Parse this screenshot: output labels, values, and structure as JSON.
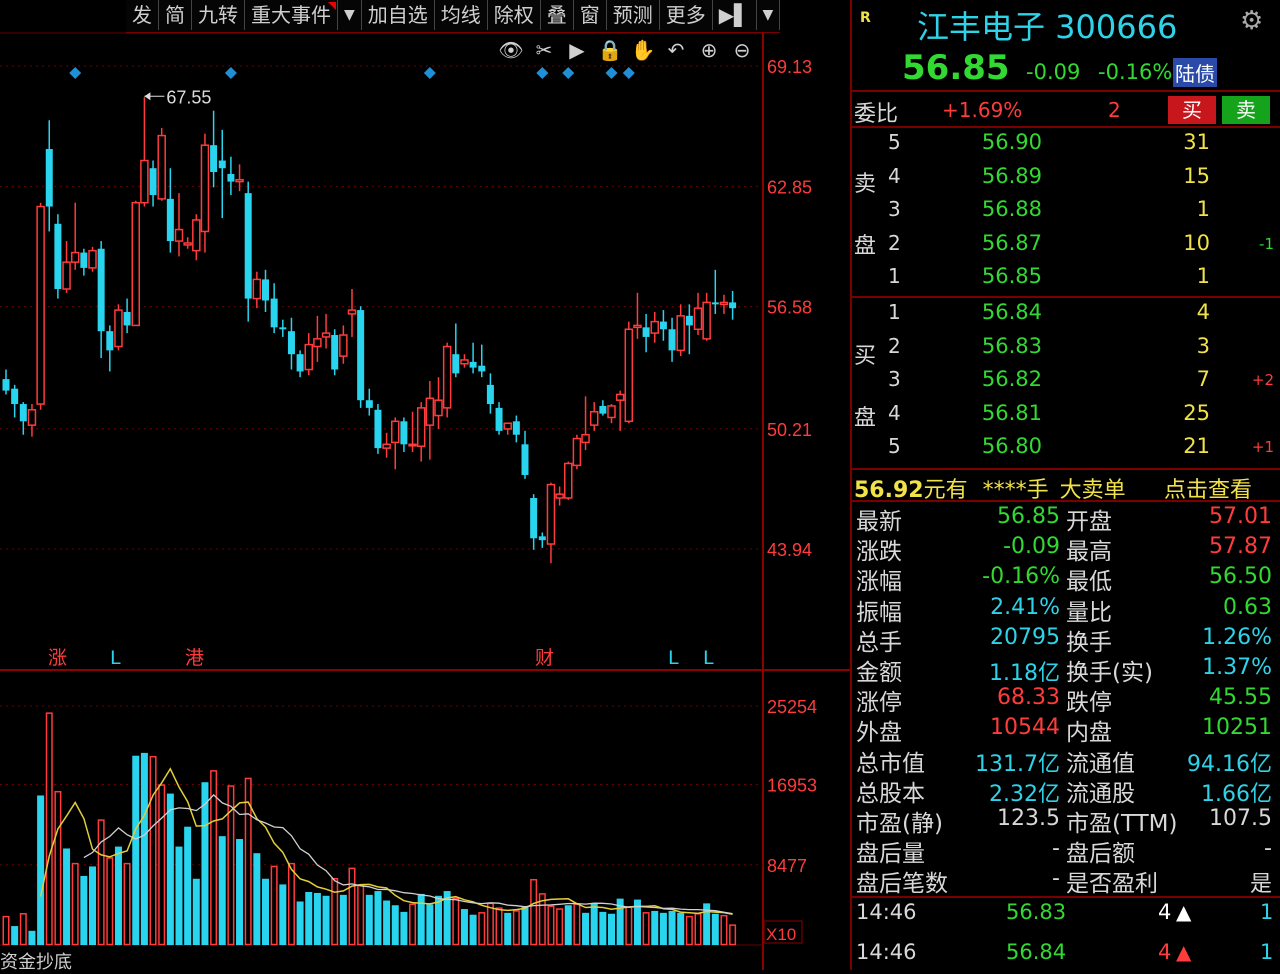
{
  "toolbar": {
    "items": [
      "发",
      "简",
      "九转",
      "重大事件",
      "加自选",
      "均线",
      "除权",
      "叠",
      "窗",
      "预测",
      "更多"
    ]
  },
  "chart_data": {
    "type": "candlestick",
    "price_axis": {
      "ticks": [
        "69.13",
        "62.85",
        "56.58",
        "50.21",
        "43.94"
      ],
      "min": 40,
      "max": 70
    },
    "volume_axis": {
      "ticks": [
        "25254",
        "16953",
        "8477"
      ],
      "unit_label": "X10"
    },
    "max_marker": "67.55",
    "event_markers": [
      "涨",
      "L",
      "港",
      "财",
      "L",
      "L"
    ],
    "candles": [
      [
        52.8,
        53.3,
        52.0,
        52.2
      ],
      [
        52.3,
        52.5,
        50.8,
        51.5
      ],
      [
        51.5,
        51.6,
        49.9,
        50.6
      ],
      [
        50.4,
        51.5,
        49.8,
        51.2
      ],
      [
        51.5,
        62.0,
        51.2,
        61.8
      ],
      [
        64.8,
        66.3,
        60.5,
        61.8
      ],
      [
        60.9,
        61.4,
        57.0,
        57.5
      ],
      [
        57.5,
        60.0,
        57.3,
        58.9
      ],
      [
        58.9,
        62.0,
        58.5,
        59.4
      ],
      [
        59.4,
        59.6,
        58.2,
        58.6
      ],
      [
        58.6,
        59.7,
        58.4,
        59.5
      ],
      [
        59.6,
        60.0,
        53.9,
        55.3
      ],
      [
        55.3,
        55.6,
        53.2,
        54.3
      ],
      [
        54.5,
        56.7,
        54.3,
        56.4
      ],
      [
        56.3,
        57.0,
        55.2,
        55.6
      ],
      [
        55.6,
        62.1,
        55.6,
        62.0
      ],
      [
        62.0,
        67.5,
        61.8,
        64.2
      ],
      [
        63.8,
        64.2,
        61.8,
        62.4
      ],
      [
        62.2,
        65.9,
        62.1,
        65.5
      ],
      [
        62.2,
        63.8,
        59.4,
        60.0
      ],
      [
        60.0,
        62.5,
        59.2,
        60.6
      ],
      [
        59.8,
        60.2,
        59.6,
        59.9
      ],
      [
        59.5,
        61.4,
        59.0,
        61.1
      ],
      [
        60.5,
        65.6,
        59.4,
        65.0
      ],
      [
        65.0,
        66.8,
        62.8,
        63.6
      ],
      [
        64.2,
        65.8,
        61.2,
        63.8
      ],
      [
        63.5,
        64.4,
        62.4,
        63.1
      ],
      [
        63.1,
        64.0,
        62.6,
        63.2
      ],
      [
        62.5,
        63.1,
        55.8,
        57.0
      ],
      [
        57.0,
        58.4,
        56.5,
        58.0
      ],
      [
        58.0,
        58.5,
        56.3,
        56.9
      ],
      [
        57.0,
        57.8,
        55.2,
        55.5
      ],
      [
        55.5,
        55.9,
        55.0,
        55.4
      ],
      [
        55.3,
        56.0,
        53.3,
        54.1
      ],
      [
        54.1,
        54.3,
        52.9,
        53.2
      ],
      [
        53.3,
        55.2,
        53.0,
        54.6
      ],
      [
        54.5,
        56.1,
        53.7,
        54.9
      ],
      [
        55.0,
        56.2,
        54.4,
        55.2
      ],
      [
        55.1,
        55.4,
        53.0,
        53.3
      ],
      [
        54.0,
        55.6,
        53.6,
        55.1
      ],
      [
        56.2,
        57.5,
        55.0,
        56.4
      ],
      [
        56.4,
        56.6,
        51.3,
        51.7
      ],
      [
        51.7,
        52.3,
        50.9,
        51.3
      ],
      [
        51.2,
        51.5,
        48.9,
        49.2
      ],
      [
        49.2,
        50.0,
        48.7,
        49.4
      ],
      [
        49.5,
        50.8,
        48.1,
        50.6
      ],
      [
        50.6,
        50.8,
        49.0,
        49.4
      ],
      [
        49.4,
        51.1,
        49.0,
        49.4
      ],
      [
        49.3,
        51.6,
        48.5,
        51.3
      ],
      [
        50.4,
        52.7,
        48.6,
        51.8
      ],
      [
        50.9,
        52.9,
        50.2,
        51.7
      ],
      [
        51.3,
        54.7,
        50.8,
        54.5
      ],
      [
        54.1,
        55.7,
        52.9,
        53.1
      ],
      [
        53.6,
        54.1,
        53.4,
        53.8
      ],
      [
        53.7,
        54.7,
        53.1,
        53.4
      ],
      [
        53.5,
        54.6,
        52.9,
        53.2
      ],
      [
        52.5,
        53.1,
        51.0,
        51.5
      ],
      [
        51.3,
        51.6,
        49.9,
        50.1
      ],
      [
        50.2,
        50.5,
        49.9,
        50.5
      ],
      [
        50.6,
        50.9,
        49.5,
        49.9
      ],
      [
        49.4,
        50.1,
        47.6,
        47.8
      ],
      [
        46.6,
        46.8,
        43.9,
        44.5
      ],
      [
        44.6,
        44.8,
        44.0,
        44.4
      ],
      [
        44.2,
        47.4,
        43.2,
        47.3
      ],
      [
        46.6,
        47.2,
        46.2,
        46.8
      ],
      [
        46.6,
        48.5,
        46.5,
        48.4
      ],
      [
        48.3,
        49.9,
        48.1,
        49.7
      ],
      [
        49.5,
        51.9,
        49.1,
        49.9
      ],
      [
        50.4,
        51.6,
        50.1,
        51.1
      ],
      [
        51.4,
        51.7,
        50.9,
        51.0
      ],
      [
        50.8,
        51.5,
        50.5,
        51.4
      ],
      [
        51.7,
        52.2,
        50.1,
        52.0
      ],
      [
        50.6,
        55.8,
        50.5,
        55.4
      ],
      [
        55.5,
        57.3,
        54.9,
        55.6
      ],
      [
        55.5,
        56.2,
        54.2,
        55.0
      ],
      [
        55.2,
        56.3,
        54.7,
        55.8
      ],
      [
        55.8,
        56.4,
        54.8,
        55.4
      ],
      [
        55.4,
        56.0,
        53.7,
        54.3
      ],
      [
        54.3,
        56.7,
        54.0,
        56.1
      ],
      [
        56.1,
        56.7,
        54.1,
        55.6
      ],
      [
        55.4,
        57.3,
        55.1,
        56.5
      ],
      [
        54.9,
        57.3,
        54.8,
        56.8
      ],
      [
        56.8,
        58.5,
        56.2,
        56.7
      ],
      [
        56.7,
        57.2,
        56.2,
        56.8
      ],
      [
        56.8,
        57.4,
        55.9,
        56.5
      ]
    ],
    "volumes": [
      [
        3000,
        "d"
      ],
      [
        2000,
        "u"
      ],
      [
        3300,
        "d"
      ],
      [
        1500,
        "u"
      ],
      [
        15800,
        "u"
      ],
      [
        24500,
        "d"
      ],
      [
        16200,
        "d"
      ],
      [
        10200,
        "u"
      ],
      [
        8600,
        "d"
      ],
      [
        7300,
        "u"
      ],
      [
        8300,
        "u"
      ],
      [
        13200,
        "d"
      ],
      [
        9200,
        "d"
      ],
      [
        10400,
        "u"
      ],
      [
        8600,
        "d"
      ],
      [
        20000,
        "u"
      ],
      [
        20300,
        "u"
      ],
      [
        19900,
        "d"
      ],
      [
        16900,
        "d"
      ],
      [
        16000,
        "u"
      ],
      [
        10400,
        "u"
      ],
      [
        12500,
        "u"
      ],
      [
        7000,
        "u"
      ],
      [
        17200,
        "u"
      ],
      [
        18400,
        "d"
      ],
      [
        11500,
        "u"
      ],
      [
        16800,
        "d"
      ],
      [
        11200,
        "u"
      ],
      [
        17600,
        "d"
      ],
      [
        9700,
        "u"
      ],
      [
        7000,
        "u"
      ],
      [
        8300,
        "d"
      ],
      [
        6400,
        "u"
      ],
      [
        8600,
        "d"
      ],
      [
        4600,
        "u"
      ],
      [
        5600,
        "u"
      ],
      [
        5500,
        "u"
      ],
      [
        5200,
        "u"
      ],
      [
        7000,
        "d"
      ],
      [
        5300,
        "u"
      ],
      [
        8100,
        "d"
      ],
      [
        6300,
        "d"
      ],
      [
        5300,
        "u"
      ],
      [
        5700,
        "u"
      ],
      [
        4700,
        "u"
      ],
      [
        4200,
        "u"
      ],
      [
        3500,
        "u"
      ],
      [
        4300,
        "d"
      ],
      [
        5400,
        "u"
      ],
      [
        4300,
        "u"
      ],
      [
        5200,
        "u"
      ],
      [
        5700,
        "u"
      ],
      [
        4900,
        "d"
      ],
      [
        3800,
        "u"
      ],
      [
        3200,
        "u"
      ],
      [
        3400,
        "d"
      ],
      [
        4400,
        "d"
      ],
      [
        3900,
        "d"
      ],
      [
        3400,
        "u"
      ],
      [
        3600,
        "d"
      ],
      [
        4100,
        "u"
      ],
      [
        6900,
        "d"
      ],
      [
        5400,
        "d"
      ],
      [
        4100,
        "d"
      ],
      [
        3800,
        "d"
      ],
      [
        4200,
        "u"
      ],
      [
        4300,
        "d"
      ],
      [
        3400,
        "u"
      ],
      [
        4400,
        "u"
      ],
      [
        3500,
        "u"
      ],
      [
        3300,
        "u"
      ],
      [
        4900,
        "u"
      ],
      [
        4000,
        "d"
      ],
      [
        4800,
        "u"
      ],
      [
        3400,
        "d"
      ],
      [
        3600,
        "u"
      ],
      [
        3400,
        "u"
      ],
      [
        3600,
        "u"
      ],
      [
        3400,
        "u"
      ],
      [
        3000,
        "d"
      ],
      [
        3300,
        "d"
      ],
      [
        4400,
        "u"
      ],
      [
        3300,
        "u"
      ],
      [
        3100,
        "d"
      ],
      [
        2100,
        "d"
      ]
    ]
  },
  "quote": {
    "badge": "R",
    "title": "江丰电子 300666",
    "price": "56.85",
    "change": "-0.09",
    "change_pct": "-0.16%",
    "tag": "陆债",
    "webi_label": "委比",
    "webi_value": "+1.69%",
    "webi_diff": "2",
    "buy_label": "买",
    "sell_label": "卖",
    "ask_side_label": [
      "卖",
      "盘"
    ],
    "bid_side_label": [
      "买",
      "盘"
    ],
    "asks": [
      {
        "level": "5",
        "price": "56.90",
        "vol": "31",
        "chg": ""
      },
      {
        "level": "4",
        "price": "56.89",
        "vol": "15",
        "chg": ""
      },
      {
        "level": "3",
        "price": "56.88",
        "vol": "1",
        "chg": ""
      },
      {
        "level": "2",
        "price": "56.87",
        "vol": "10",
        "chg": "-1"
      },
      {
        "level": "1",
        "price": "56.85",
        "vol": "1",
        "chg": ""
      }
    ],
    "bids": [
      {
        "level": "1",
        "price": "56.84",
        "vol": "4",
        "chg": ""
      },
      {
        "level": "2",
        "price": "56.83",
        "vol": "3",
        "chg": ""
      },
      {
        "level": "3",
        "price": "56.82",
        "vol": "7",
        "chg": "+2"
      },
      {
        "level": "4",
        "price": "56.81",
        "vol": "25",
        "chg": ""
      },
      {
        "level": "5",
        "price": "56.80",
        "vol": "21",
        "chg": "+1"
      }
    ],
    "alert": {
      "price": "56.92",
      "unit": "元有",
      "qty": "****手",
      "kind": "大卖单",
      "link": "点击查看"
    },
    "stats": [
      {
        "l1": "最新",
        "v1": "56.85",
        "c1": "green",
        "l2": "开盘",
        "v2": "57.01",
        "c2": "red"
      },
      {
        "l1": "涨跌",
        "v1": "-0.09",
        "c1": "green",
        "l2": "最高",
        "v2": "57.87",
        "c2": "red"
      },
      {
        "l1": "涨幅",
        "v1": "-0.16%",
        "c1": "green",
        "l2": "最低",
        "v2": "56.50",
        "c2": "green"
      },
      {
        "l1": "振幅",
        "v1": "2.41%",
        "c1": "cyan",
        "l2": "量比",
        "v2": "0.63",
        "c2": "green"
      },
      {
        "l1": "总手",
        "v1": "20795",
        "c1": "cyan",
        "l2": "换手",
        "v2": "1.26%",
        "c2": "cyan"
      },
      {
        "l1": "金额",
        "v1": "1.18亿",
        "c1": "cyan",
        "l2": "换手(实)",
        "v2": "1.37%",
        "c2": "cyan"
      },
      {
        "l1": "涨停",
        "v1": "68.33",
        "c1": "red",
        "l2": "跌停",
        "v2": "45.55",
        "c2": "green"
      },
      {
        "l1": "外盘",
        "v1": "10544",
        "c1": "red",
        "l2": "内盘",
        "v2": "10251",
        "c2": "green"
      },
      {
        "l1": "总市值",
        "v1": "131.7亿",
        "c1": "cyan",
        "l2": "流通值",
        "v2": "94.16亿",
        "c2": "cyan"
      },
      {
        "l1": "总股本",
        "v1": "2.32亿",
        "c1": "cyan",
        "l2": "流通股",
        "v2": "1.66亿",
        "c2": "cyan"
      },
      {
        "l1": "市盈(静)",
        "v1": "123.5",
        "c1": "white",
        "l2": "市盈(TTM)",
        "v2": "107.5",
        "c2": "white"
      },
      {
        "l1": "盘后量",
        "v1": "-",
        "c1": "white",
        "l2": "盘后额",
        "v2": "-",
        "c2": "white"
      },
      {
        "l1": "盘后笔数",
        "v1": "-",
        "c1": "white",
        "l2": "是否盈利",
        "v2": "是",
        "c2": "white"
      }
    ],
    "ticks": [
      {
        "time": "14:46",
        "price": "56.83",
        "vol": "4",
        "dir": "up-white",
        "n": "1"
      },
      {
        "time": "14:46",
        "price": "56.84",
        "vol": "4",
        "dir": "up-red",
        "n": "1"
      }
    ],
    "bottom_label": "资金抄底"
  },
  "colors": {
    "up": "#ff3b3b",
    "down": "#29d4ee",
    "grid": "#8b0000",
    "ma_white": "#d0d0d0",
    "ma_yellow": "#e0cf3a",
    "marker": "#1f8fd6"
  }
}
